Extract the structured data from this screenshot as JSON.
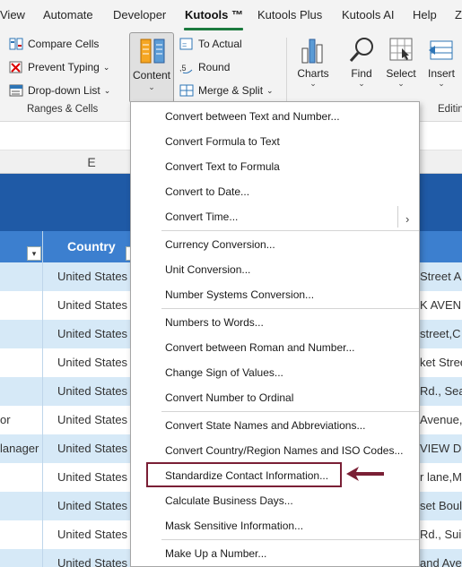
{
  "ribbon_tabs": [
    "View",
    "Automate",
    "Developer",
    "Kutools ™",
    "Kutools Plus",
    "Kutools AI",
    "Help",
    "Z"
  ],
  "ribbon": {
    "compare_cells": "Compare Cells",
    "prevent_typing": "Prevent Typing",
    "dropdown_list": "Drop-down List",
    "group_ranges": "Ranges & Cells",
    "content": "Content",
    "to_actual": "To Actual",
    "round": "Round",
    "merge_split": "Merge & Split",
    "charts": "Charts",
    "find": "Find",
    "select": "Select",
    "insert": "Insert",
    "group_editing": "Editin"
  },
  "sheet": {
    "column_letter": "E",
    "header_country": "Country",
    "rows": [
      {
        "left": "",
        "country": "United States",
        "right": "Street A"
      },
      {
        "left": "",
        "country": "United States",
        "right": "K AVENU"
      },
      {
        "left": "",
        "country": "United States",
        "right": "street,C"
      },
      {
        "left": "",
        "country": "United States",
        "right": "ket Stree"
      },
      {
        "left": "",
        "country": "United States",
        "right": "Rd., Sea"
      },
      {
        "left": "or",
        "country": "United States",
        "right": "Avenue,"
      },
      {
        "left": "lanager",
        "country": "United States",
        "right": "VIEW D"
      },
      {
        "left": "",
        "country": "United States",
        "right": "r lane,Mi"
      },
      {
        "left": "",
        "country": "United States",
        "right": "set Boule"
      },
      {
        "left": "",
        "country": "United States",
        "right": "Rd., Sui"
      },
      {
        "left": "",
        "country": "United States",
        "right": "and Ave"
      }
    ]
  },
  "menu": {
    "items": [
      "Convert between Text and Number...",
      "Convert Formula to Text",
      "Convert Text to Formula",
      "Convert to Date...",
      "Convert Time...",
      "Currency Conversion...",
      "Unit Conversion...",
      "Number Systems Conversion...",
      "Numbers to Words...",
      "Convert between Roman and Number...",
      "Change Sign of Values...",
      "Convert Number to Ordinal",
      "Convert State Names and Abbreviations...",
      "Convert Country/Region Names and ISO Codes...",
      "Standardize Contact Information...",
      "Calculate Business Days...",
      "Mask Sensitive Information...",
      "Make Up a Number..."
    ],
    "submenu_arrow": "›"
  },
  "colors": {
    "accent_tab": "#1b7a3e",
    "title_band": "#1f5aa6",
    "header_row": "#3c7fcf",
    "stripe": "#d6e9f7",
    "highlight": "#7a1f35"
  }
}
